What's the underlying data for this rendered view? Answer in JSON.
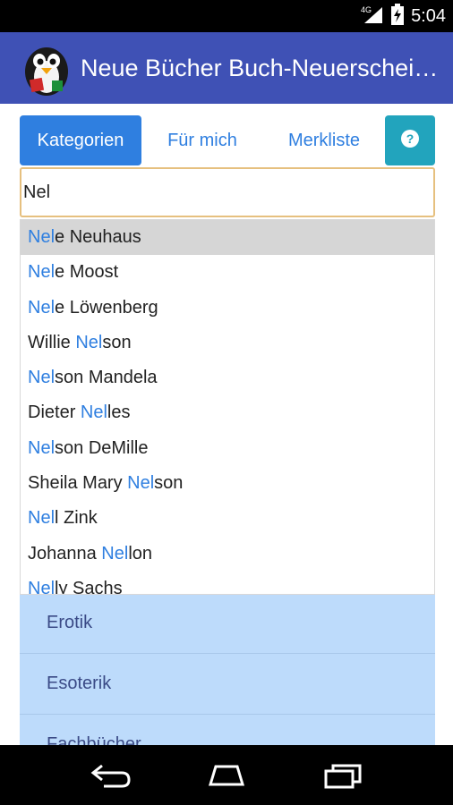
{
  "status_bar": {
    "time": "5:04",
    "network_label": "4G"
  },
  "app_bar": {
    "title": "Neue Bücher Buch-Neuerscheinungen"
  },
  "tabs": [
    {
      "label": "Kategorien",
      "active": true
    },
    {
      "label": "Für mich",
      "active": false
    },
    {
      "label": "Merkliste",
      "active": false
    }
  ],
  "help_button": {
    "icon": "help-icon"
  },
  "search": {
    "value": "Nel"
  },
  "suggestions": [
    {
      "before": "",
      "match": "Nel",
      "after": "e Neuhaus",
      "highlighted": true
    },
    {
      "before": "",
      "match": "Nel",
      "after": "e Moost"
    },
    {
      "before": "",
      "match": "Nel",
      "after": "e Löwenberg"
    },
    {
      "before": "Willie ",
      "match": "Nel",
      "after": "son"
    },
    {
      "before": "",
      "match": "Nel",
      "after": "son Mandela"
    },
    {
      "before": "Dieter ",
      "match": "Nel",
      "after": "les"
    },
    {
      "before": "",
      "match": "Nel",
      "after": "son DeMille"
    },
    {
      "before": "Sheila Mary ",
      "match": "Nel",
      "after": "son"
    },
    {
      "before": "",
      "match": "Nel",
      "after": "l Zink"
    },
    {
      "before": "Johanna ",
      "match": "Nel",
      "after": "lon"
    },
    {
      "before": "",
      "match": "Nel",
      "after": "ly Sachs"
    }
  ],
  "categories": [
    {
      "label": "Erotik"
    },
    {
      "label": "Esoterik"
    },
    {
      "label": "Fachbücher"
    }
  ],
  "colors": {
    "app_bar": "#3f51b5",
    "accent": "#2f7fe0",
    "help": "#22a4bd",
    "category_bg": "#bddbfb"
  }
}
